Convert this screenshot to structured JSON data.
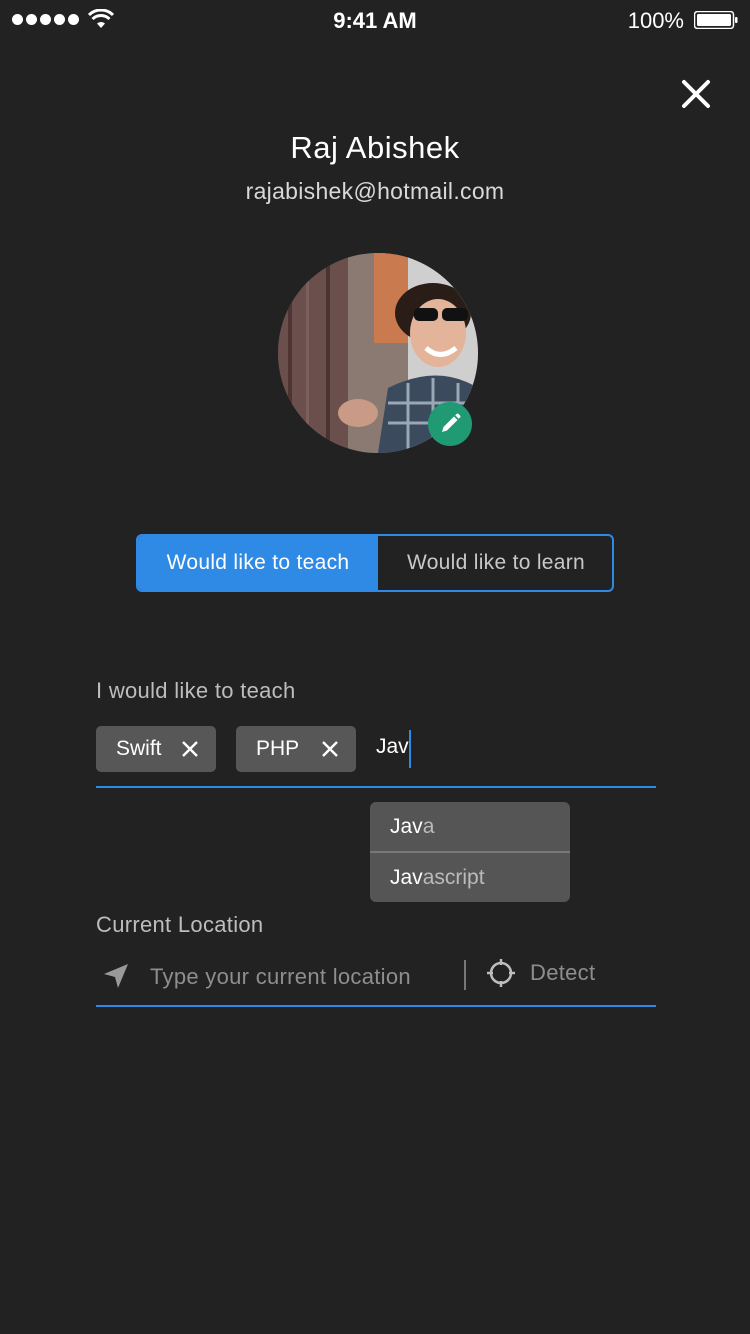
{
  "status_bar": {
    "time": "9:41 AM",
    "battery": "100%"
  },
  "profile": {
    "name": "Raj Abishek",
    "email": "rajabishek@hotmail.com"
  },
  "mode_toggle": {
    "teach_label": "Would like to teach",
    "learn_label": "Would like to learn",
    "selected": "teach"
  },
  "teach_section": {
    "label": "I would like to teach",
    "chips": [
      {
        "label": "Swift"
      },
      {
        "label": "PHP"
      }
    ],
    "typed_value": "Jav"
  },
  "suggestions": [
    {
      "match": "Jav",
      "rest": "a"
    },
    {
      "match": "Jav",
      "rest": "ascript"
    }
  ],
  "location": {
    "label": "Current Location",
    "placeholder": "Type your current location",
    "detect_label": "Detect"
  },
  "colors": {
    "background": "#222222",
    "accent": "#2f8ae5",
    "edit_badge": "#1f9a72",
    "chip": "#575757"
  }
}
